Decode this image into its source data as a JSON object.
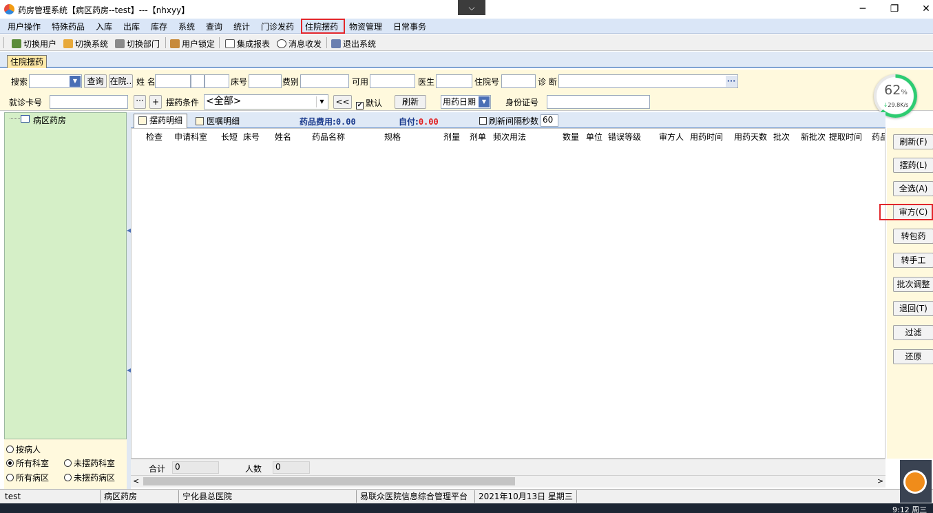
{
  "window": {
    "title": "药房管理系统【病区药房--test】---【nhxyy】",
    "chevron": "⌵",
    "minimize": "─",
    "restore": "❐",
    "close": "✕"
  },
  "menubar": [
    "用户操作",
    "特殊药品",
    "入库",
    "出库",
    "库存",
    "系统",
    "查询",
    "统计",
    "门诊发药",
    "住院摆药",
    "物资管理",
    "日常事务"
  ],
  "toolbar": [
    "切换用户",
    "切换系统",
    "切换部门",
    "用户锁定",
    "集成报表",
    "消息收发",
    "退出系统"
  ],
  "tab": "住院摆药",
  "search": {
    "row1": {
      "search_label": "搜索",
      "query_button": "查询",
      "inhospital_button": "在院..",
      "name_label": "姓 名",
      "bed_label": "床号",
      "fee_label": "费别",
      "available_label": "可用",
      "doctor_label": "医生",
      "admission_label": "住院号",
      "diagnosis_label": "诊 断",
      "ellipsis": "···"
    },
    "row2": {
      "card_label": "就诊卡号",
      "dots_button": "···",
      "plus_button": "+",
      "condition_label": "摆药条件",
      "condition_value": "<全部>",
      "back_button": "<<",
      "default_label": "默认",
      "refresh_button": "刷新",
      "date_select": "用药日期",
      "id_label": "身份证号"
    }
  },
  "network": {
    "percent": "62",
    "percent_sign": "%",
    "speed": "29.8K/s"
  },
  "tree": {
    "root": "病区药房"
  },
  "radios": {
    "by_patient": "按病人",
    "all_dept": "所有科室",
    "not_dept": "未摆药科室",
    "all_ward": "所有病区",
    "not_ward": "未摆药病区"
  },
  "detail": {
    "tab1": "摆药明细",
    "tab2": "医嘱明细",
    "fee_label": "药品费用:",
    "fee_value": "0.00",
    "self_label": "自付:",
    "self_value": "0.00",
    "interval_label": "刷新间隔秒数",
    "interval_value": "60"
  },
  "grid": {
    "columns": [
      "检查",
      "申请科室",
      "长短",
      "床号",
      "姓名",
      "药品名称",
      "规格",
      "剂量",
      "剂单",
      "频次用法",
      "数量",
      "单位",
      "错误等级",
      "审方人",
      "用药时间",
      "用药天数",
      "批次",
      "新批次",
      "提取时间",
      "药品"
    ],
    "rows": [],
    "summary_total_label": "合计",
    "summary_total_value": "0",
    "summary_count_label": "人数",
    "summary_count_value": "0"
  },
  "actions": [
    "刷新(F)",
    "摆药(L)",
    "全选(A)",
    "审方(C)",
    "转包药",
    "转手工",
    "批次调整",
    "退回(T)",
    "过滤",
    "还原"
  ],
  "status": {
    "user": "test",
    "dept": "病区药房",
    "hospital": "宁化县总医院",
    "platform": "易联众医院信息综合管理平台",
    "date": "2021年10月13日 星期三"
  },
  "taskbar": {
    "clock": "9:12 周三"
  },
  "colors": {
    "highlight": "#e2262b",
    "menubar": "#dae6f7",
    "panel": "#fff9dd",
    "tree": "#d5efc7",
    "fee": "#1a3a8c",
    "self": "#e11d1d"
  }
}
